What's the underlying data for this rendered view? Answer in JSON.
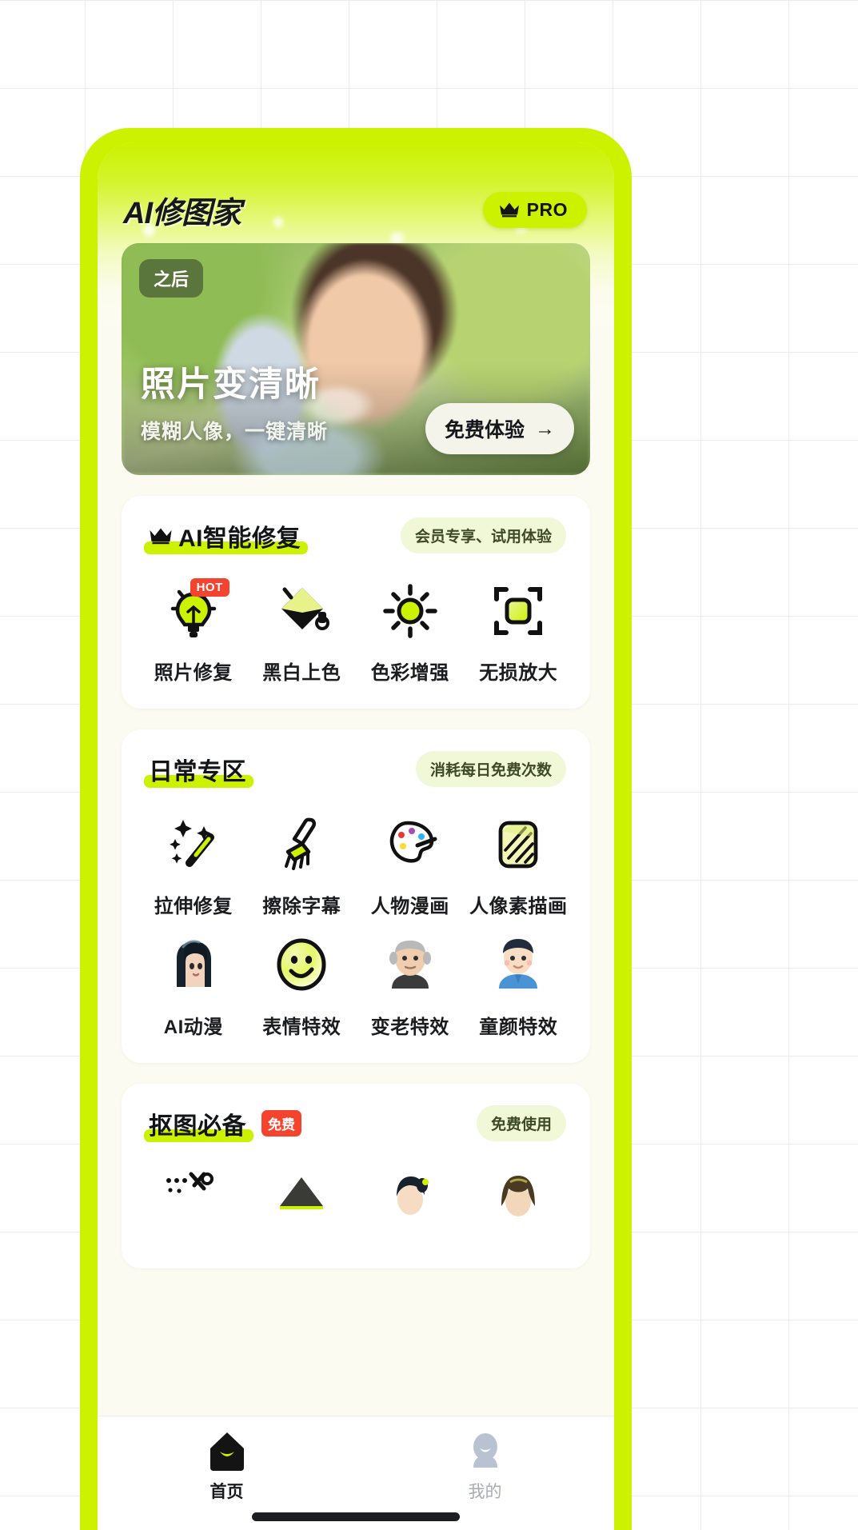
{
  "header": {
    "app_title": "AI修图家",
    "pro_label": "PRO",
    "crown_icon": "crown-icon"
  },
  "hero": {
    "tag": "之后",
    "title": "照片变清晰",
    "subtitle": "模糊人像，一键清晰",
    "cta_label": "免费体验",
    "cta_arrow": "→"
  },
  "sections": [
    {
      "id": "ai-repair",
      "title": "AI智能修复",
      "has_crown": true,
      "badge": "会员专享、试用体验",
      "items": [
        {
          "label": "照片修复",
          "icon": "lightbulb-icon",
          "tag": "HOT"
        },
        {
          "label": "黑白上色",
          "icon": "paint-bucket-icon",
          "tag": ""
        },
        {
          "label": "色彩增强",
          "icon": "brightness-sun-icon",
          "tag": ""
        },
        {
          "label": "无损放大",
          "icon": "scan-expand-icon",
          "tag": ""
        }
      ]
    },
    {
      "id": "daily-zone",
      "title": "日常专区",
      "has_crown": false,
      "badge": "消耗每日免费次数",
      "items": [
        {
          "label": "拉伸修复",
          "icon": "magic-wand-icon",
          "tag": ""
        },
        {
          "label": "擦除字幕",
          "icon": "brush-icon",
          "tag": ""
        },
        {
          "label": "人物漫画",
          "icon": "palette-icon",
          "tag": ""
        },
        {
          "label": "人像素描画",
          "icon": "sketch-icon",
          "tag": ""
        },
        {
          "label": "AI动漫",
          "icon": "anime-portrait-icon",
          "tag": ""
        },
        {
          "label": "表情特效",
          "icon": "smiley-face-icon",
          "tag": ""
        },
        {
          "label": "变老特效",
          "icon": "old-person-icon",
          "tag": ""
        },
        {
          "label": "童颜特效",
          "icon": "young-person-icon",
          "tag": ""
        }
      ]
    },
    {
      "id": "cutout-essentials",
      "title": "抠图必备",
      "has_crown": false,
      "free_tag": "免费",
      "badge": "免费使用",
      "items": [
        {
          "label": "",
          "icon": "scissors-cutout-icon",
          "tag": ""
        },
        {
          "label": "",
          "icon": "mountain-icon",
          "tag": ""
        },
        {
          "label": "",
          "icon": "person-dark-hair-icon",
          "tag": ""
        },
        {
          "label": "",
          "icon": "person-brown-hair-icon",
          "tag": ""
        }
      ]
    }
  ],
  "bottom_nav": {
    "items": [
      {
        "label": "首页",
        "icon": "home-icon",
        "active": true
      },
      {
        "label": "我的",
        "icon": "profile-icon",
        "active": false
      }
    ]
  },
  "colors": {
    "accent_green": "#CCF200",
    "badge_bg": "#f1f8d8",
    "hot_red": "#f4432f",
    "text_dark": "#121416"
  }
}
